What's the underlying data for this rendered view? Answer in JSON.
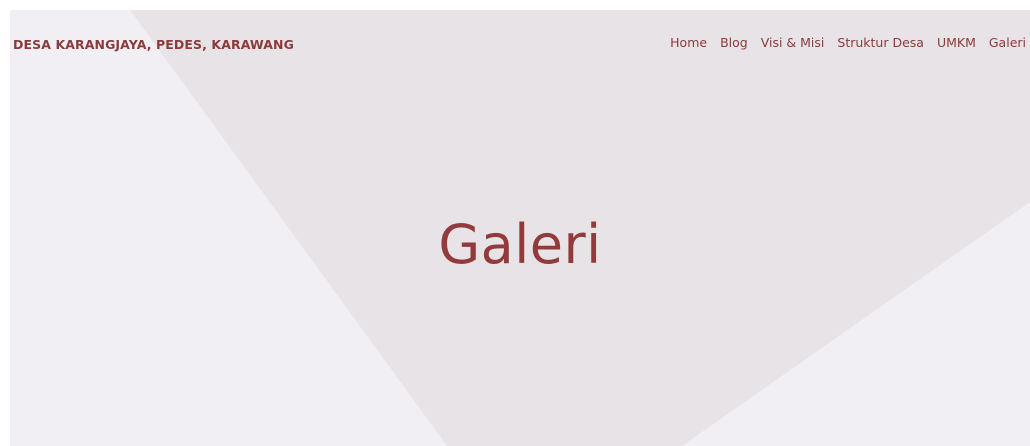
{
  "site": {
    "brand": "DESA KARANGJAYA, PEDES, KARAWANG"
  },
  "nav": {
    "items": [
      {
        "label": "Home"
      },
      {
        "label": "Blog"
      },
      {
        "label": "Visi & Misi"
      },
      {
        "label": "Struktur Desa"
      },
      {
        "label": "UMKM"
      },
      {
        "label": "Galeri"
      }
    ]
  },
  "hero": {
    "title": "Galeri"
  },
  "colors": {
    "accent": "#8a3b3c",
    "background": "#f1eff3",
    "shape": "#e8e3e6"
  }
}
